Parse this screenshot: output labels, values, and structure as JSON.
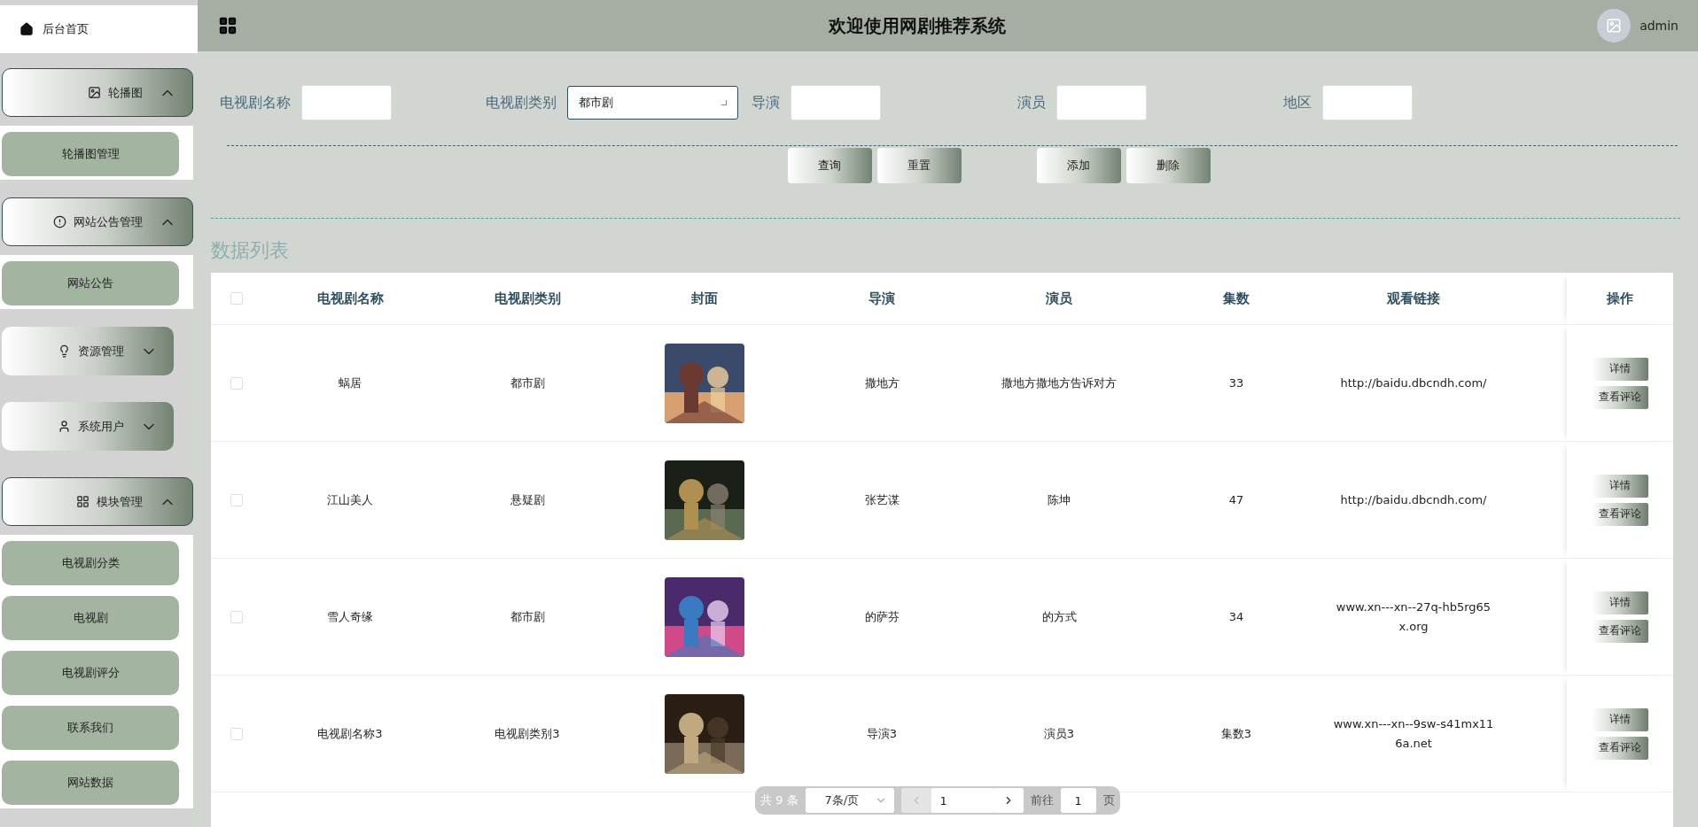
{
  "sidebar": {
    "home": {
      "label": "后台首页",
      "selected": true
    },
    "groups": [
      {
        "label": "轮播图",
        "expanded": true,
        "children": [
          {
            "label": "轮播图管理"
          }
        ]
      },
      {
        "label": "网站公告管理",
        "expanded": true,
        "children": [
          {
            "label": "网站公告"
          }
        ]
      },
      {
        "label": "资源管理",
        "expanded": false
      },
      {
        "label": "系统用户",
        "expanded": false
      },
      {
        "label": "模块管理",
        "expanded": true,
        "children": [
          {
            "label": "电视剧分类"
          },
          {
            "label": "电视剧"
          },
          {
            "label": "电视剧评分"
          },
          {
            "label": "联系我们"
          },
          {
            "label": "网站数据"
          }
        ]
      }
    ]
  },
  "header": {
    "title": "欢迎使用网剧推荐系统",
    "user": "admin"
  },
  "search": {
    "fields": [
      {
        "label": "电视剧名称",
        "kind": "input"
      },
      {
        "label": "电视剧类别",
        "kind": "select",
        "value": "都市剧"
      },
      {
        "label": "导演",
        "kind": "input"
      },
      {
        "label": "演员",
        "kind": "input"
      },
      {
        "label": "地区",
        "kind": "input"
      }
    ],
    "button_groups": [
      [
        "查询",
        "重置"
      ],
      [
        "添加",
        "删除"
      ]
    ]
  },
  "section_title": "数据列表",
  "table": {
    "all_checked": false,
    "columns": [
      "电视剧名称",
      "电视剧类别",
      "封面",
      "导演",
      "演员",
      "集数",
      "观看链接",
      "操作"
    ],
    "rows": [
      {
        "checked": false,
        "name": "蜗居",
        "category": "都市剧",
        "director": "撒地方",
        "actors": "撒地方撒地方告诉对方",
        "episodes": "33",
        "link": "http://baidu.dbcndh.com/",
        "actions": [
          "详情",
          "查看评论"
        ]
      },
      {
        "checked": false,
        "name": "江山美人",
        "category": "悬疑剧",
        "director": "张艺谋",
        "actors": "陈坤",
        "episodes": "47",
        "link": "http://baidu.dbcndh.com/",
        "actions": [
          "详情",
          "查看评论"
        ]
      },
      {
        "checked": false,
        "name": "雪人奇缘",
        "category": "都市剧",
        "director": "的萨芬",
        "actors": "的方式",
        "episodes": "34",
        "link": "www.xn---xn--27q-hb5rg65x.org",
        "actions": [
          "详情",
          "查看评论"
        ]
      },
      {
        "checked": false,
        "name": "电视剧名称3",
        "category": "电视剧类别3",
        "director": "导演3",
        "actors": "演员3",
        "episodes": "集数3",
        "link": "www.xn---xn--9sw-s41mx116a.net",
        "actions": [
          "详情",
          "查看评论"
        ]
      }
    ]
  },
  "pagination": {
    "total": "共 9 条",
    "page_size": "7条/页",
    "page": "1",
    "goto_label": "前往",
    "goto_value": "1",
    "goto_suffix": "页",
    "prev_disabled": true
  }
}
